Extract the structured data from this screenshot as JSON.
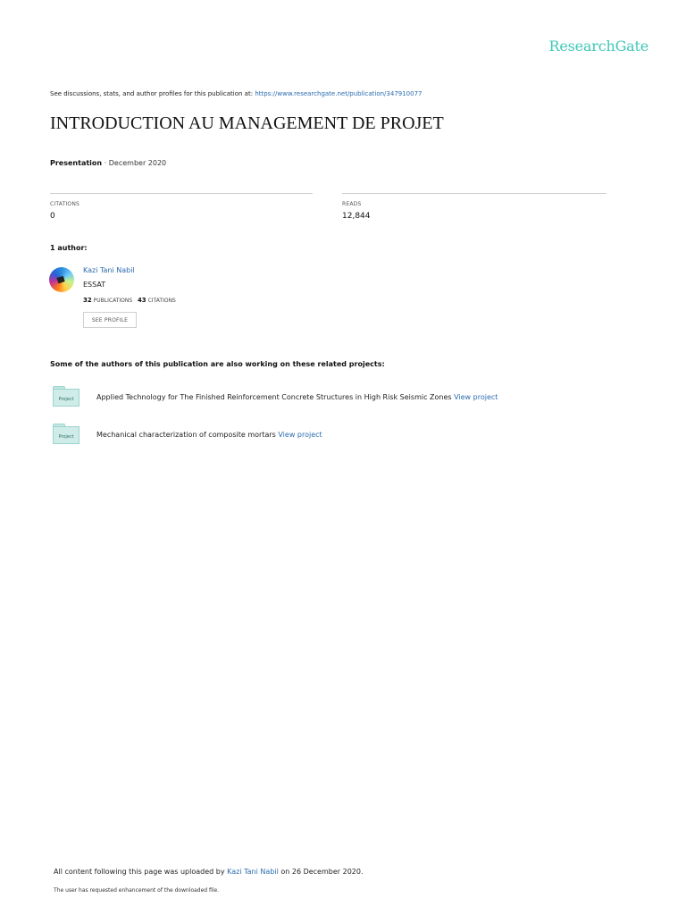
{
  "brand": "ResearchGate",
  "topline": {
    "text": "See discussions, stats, and author profiles for this publication at: ",
    "url": "https://www.researchgate.net/publication/347910077"
  },
  "title": "INTRODUCTION AU MANAGEMENT DE PROJET",
  "meta": {
    "type": "Presentation",
    "separator": " · ",
    "date": "December 2020"
  },
  "stats": {
    "citations_label": "CITATIONS",
    "citations_value": "0",
    "reads_label": "READS",
    "reads_value": "12,844"
  },
  "authors_label": "1 author:",
  "author": {
    "name": "Kazi Tani Nabil",
    "institution": "ESSAT",
    "publications_count": "32",
    "publications_label": "PUBLICATIONS",
    "citations_count": "43",
    "citations_label": "CITATIONS",
    "profile_button": "SEE PROFILE"
  },
  "related_label": "Some of the authors of this publication are also working on these related projects:",
  "projects": [
    {
      "folder_label": "Project",
      "text": "Applied Technology for The Finished Reinforcement Concrete Structures in High Risk Seismic Zones ",
      "link": "View project"
    },
    {
      "folder_label": "Project",
      "text": "Mechanical characterization of composite mortars ",
      "link": "View project"
    }
  ],
  "footer": {
    "uploaded_prefix": "All content following this page was uploaded by ",
    "uploader": "Kazi Tani Nabil",
    "uploaded_suffix": " on 26 December 2020.",
    "note": "The user has requested enhancement of the downloaded file."
  }
}
